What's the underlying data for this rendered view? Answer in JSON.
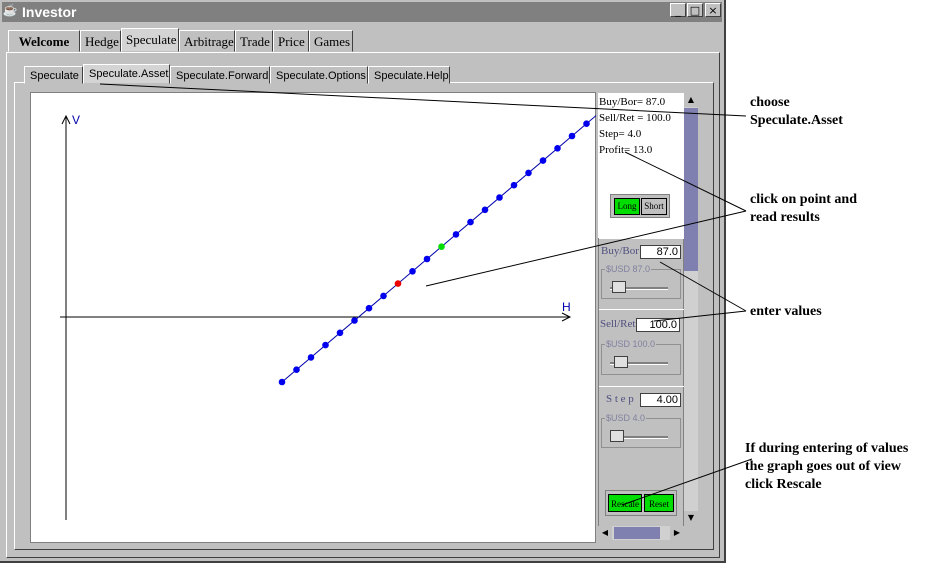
{
  "window": {
    "title": "Investor",
    "icon": "coffee-cup-icon",
    "minimize": "_",
    "maximize": "□",
    "close": "×"
  },
  "tabs": [
    {
      "label": "Welcome",
      "selected": false
    },
    {
      "label": "Hedge",
      "selected": false
    },
    {
      "label": "Speculate",
      "selected": true
    },
    {
      "label": "Arbitrage",
      "selected": false
    },
    {
      "label": "Trade",
      "selected": false
    },
    {
      "label": "Price",
      "selected": false
    },
    {
      "label": "Games",
      "selected": false
    }
  ],
  "subtabs": [
    {
      "label": "Speculate",
      "selected": false
    },
    {
      "label": "Speculate.Asset",
      "selected": true
    },
    {
      "label": "Speculate.Forward",
      "selected": false
    },
    {
      "label": "Speculate.Options",
      "selected": false
    },
    {
      "label": "Speculate.Help",
      "selected": false
    }
  ],
  "info": {
    "buy": "Buy/Bor= 87.0",
    "sell": "Sell/Ret = 100.0",
    "step": "Step= 4.0",
    "profit": "Profit= 13.0"
  },
  "position_buttons": {
    "long": "Long",
    "short": "Short"
  },
  "buy_section": {
    "label": "Buy/Bor",
    "value": "87.0",
    "slider_title": "$USD 87.0",
    "slider_level": 0.05
  },
  "sell_section": {
    "label": "Sell/Ret",
    "value": "100.0",
    "slider_title": "$USD 100.0",
    "slider_level": 0.08
  },
  "step_section": {
    "label": "S t e p",
    "value": "4.00",
    "slider_title": "$USD 4.0",
    "slider_level": 0.0
  },
  "action_buttons": {
    "rescale": "Rescale",
    "reset": "Reset"
  },
  "chart_data": {
    "type": "scatter",
    "x_axis_label": "H",
    "y_axis_label": "V",
    "colors": {
      "points": "#0000ee",
      "selected": "#00dd00",
      "zero": "#ee0000",
      "line": "#0000aa"
    },
    "points_count": 25,
    "zero_index": 8,
    "selected_index": 11
  },
  "annotations": {
    "choose": [
      "choose",
      "Speculate.Asset"
    ],
    "click": [
      "click on point and",
      "read results"
    ],
    "enter": [
      "enter values"
    ],
    "rescale": [
      "If during entering of values",
      "the graph goes out of view",
      "click Rescale"
    ]
  },
  "colors": {
    "window_bg": "#c0c0c0",
    "title_bg": "#808080",
    "button_green": "#00dd00"
  }
}
